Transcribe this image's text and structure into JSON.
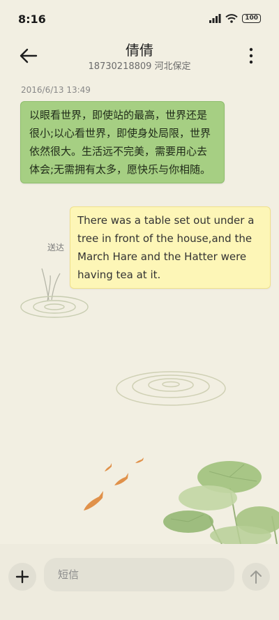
{
  "status_bar": {
    "time": "8:16",
    "battery": "100",
    "icons": [
      "signal-icon",
      "wifi-icon",
      "battery-icon"
    ]
  },
  "header": {
    "title": "倩倩",
    "subtitle": "18730218809 河北保定",
    "icons": [
      "back-arrow-icon",
      "more-vertical-icon"
    ]
  },
  "conversation": {
    "timestamp": "2016/6/13 13:49",
    "messages": [
      {
        "direction": "incoming",
        "text": "以眼看世界，即使站的最高，世界还是很小;以心看世界，即使身处局限，世界依然很大。生活远不完美，需要用心去体会;无需拥有太多，愿快乐与你相随。"
      },
      {
        "direction": "outgoing",
        "text": "There was a table set out under a tree in front of the house,and the March Hare and the Hatter were having tea at it.",
        "status": "送达"
      }
    ]
  },
  "composer": {
    "placeholder": "短信",
    "value": "",
    "icons": [
      "plus-icon",
      "send-arrow-icon"
    ]
  },
  "colors": {
    "background": "#f2efe2",
    "incoming_bubble": "#a6cf83",
    "outgoing_bubble": "#fdf6b7"
  }
}
